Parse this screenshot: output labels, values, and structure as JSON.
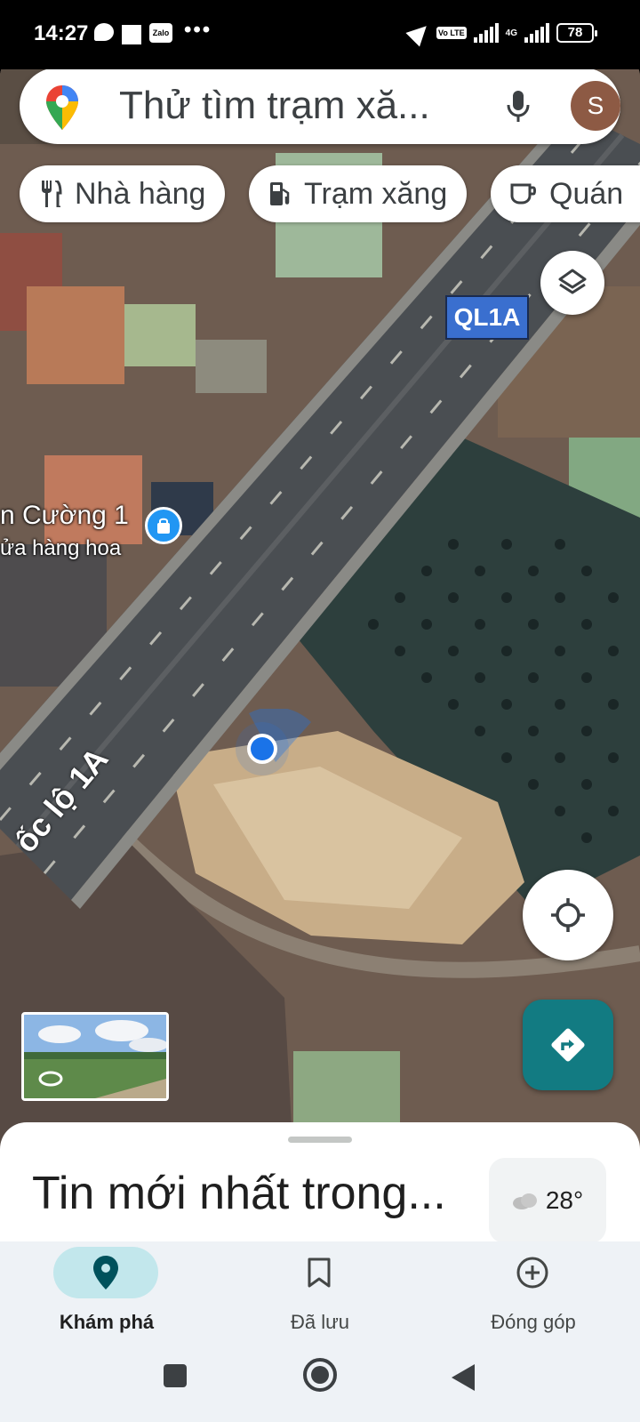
{
  "status_bar": {
    "time": "14:27",
    "zalo_label": "Zalo",
    "dots": "•••",
    "volte": "Vo LTE",
    "network": "4G",
    "battery": "78"
  },
  "search": {
    "placeholder": "Thử tìm trạm xă...",
    "avatar_letter": "S"
  },
  "chips": [
    {
      "label": "Nhà hàng",
      "icon": "restaurant-icon"
    },
    {
      "label": "Trạm xăng",
      "icon": "gas-station-icon"
    },
    {
      "label": "Quán",
      "icon": "cafe-icon"
    }
  ],
  "map": {
    "route_badge": "QL1A",
    "poi_name": "n Cường 1",
    "poi_sub": "ửa hàng hoa",
    "road_label": "ốc lộ 1A"
  },
  "sheet": {
    "title": "Tin mới nhất trong...",
    "temperature": "28°"
  },
  "nav": [
    {
      "label": "Khám phá",
      "icon": "explore-pin-icon",
      "active": true
    },
    {
      "label": "Đã lưu",
      "icon": "bookmark-icon",
      "active": false
    },
    {
      "label": "Đóng góp",
      "icon": "add-circle-icon",
      "active": false
    }
  ],
  "colors": {
    "accent": "#127b82",
    "nav_active_bg": "#c2e7ec",
    "route_badge": "#3a6fcf",
    "my_location": "#1a73e8"
  }
}
